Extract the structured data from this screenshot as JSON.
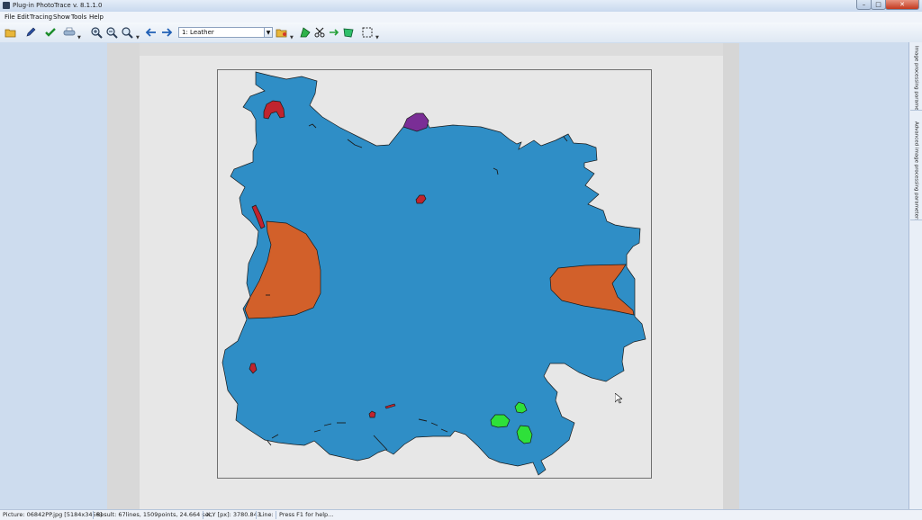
{
  "window": {
    "title": "Plug-in PhotoTrace v. 8.1.1.0",
    "minimize_icon": "minimize-icon",
    "maximize_icon": "maximize-icon",
    "close_icon": "close-icon"
  },
  "menu": {
    "items": [
      "File",
      "Edit",
      "Tracing",
      "Show",
      "Tools",
      "Help"
    ]
  },
  "toolbar": {
    "layer_value": "1: Leather",
    "icons": [
      "open-folder-icon",
      "pen-icon",
      "checkmark-icon",
      "printer-icon",
      "zoom-in-icon",
      "zoom-out-icon",
      "zoom-select-icon",
      "arrow-left-icon",
      "arrow-right-icon",
      "layer-folder-icon",
      "polygon-icon",
      "scissors-icon",
      "arrow-right-green-icon",
      "fill-shape-icon",
      "selection-rect-icon"
    ]
  },
  "side_panel": {
    "tabs": [
      "Image processing parameters",
      "Advanced image processing parameters"
    ]
  },
  "status": {
    "picture": "Picture: 06842PP.jpg [5184x3456]",
    "result": "Result: 67lines, 1509points, 24.664 sec.",
    "coords": "X,Y [px]: 3780.843",
    "line": "Line:",
    "help": "Press F1 for help..."
  },
  "colors": {
    "hide_fill": "#2f8ec6",
    "defect_orange": "#d2602a",
    "defect_red": "#c0242e",
    "defect_purple": "#7a2e96",
    "defect_green": "#2ee03a"
  }
}
